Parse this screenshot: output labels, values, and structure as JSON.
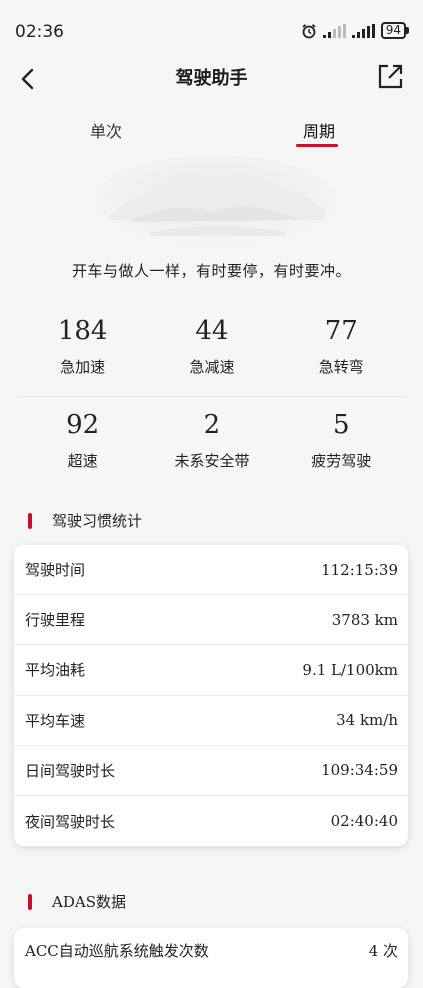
{
  "status": {
    "time": "02:36",
    "battery": "94"
  },
  "header": {
    "title": "驾驶助手",
    "back_icon": "back-arrow-icon",
    "share_icon": "share-export-icon"
  },
  "tabs": [
    {
      "label": "单次"
    },
    {
      "label": "周期",
      "selected": true
    }
  ],
  "accent_color": "#c8102e",
  "slogan": "开车与做人一样，有时要停，有时要冲。",
  "stats": [
    {
      "value": "184",
      "label": "急加速"
    },
    {
      "value": "44",
      "label": "急减速"
    },
    {
      "value": "77",
      "label": "急转弯"
    },
    {
      "value": "92",
      "label": "超速"
    },
    {
      "value": "2",
      "label": "未系安全带"
    },
    {
      "value": "5",
      "label": "疲劳驾驶"
    }
  ],
  "habit_section": {
    "title": "驾驶习惯统计",
    "rows": [
      {
        "label": "驾驶时间",
        "value": "112:15:39"
      },
      {
        "label": "行驶里程",
        "value": "3783 km"
      },
      {
        "label": "平均油耗",
        "value": "9.1 L/100km"
      },
      {
        "label": "平均车速",
        "value": "34 km/h"
      },
      {
        "label": "日间驾驶时长",
        "value": "109:34:59"
      },
      {
        "label": "夜间驾驶时长",
        "value": "02:40:40"
      }
    ]
  },
  "adas_section": {
    "title": "ADAS数据",
    "rows": [
      {
        "label": "ACC自动巡航系统触发次数",
        "value": "4 次"
      }
    ]
  }
}
